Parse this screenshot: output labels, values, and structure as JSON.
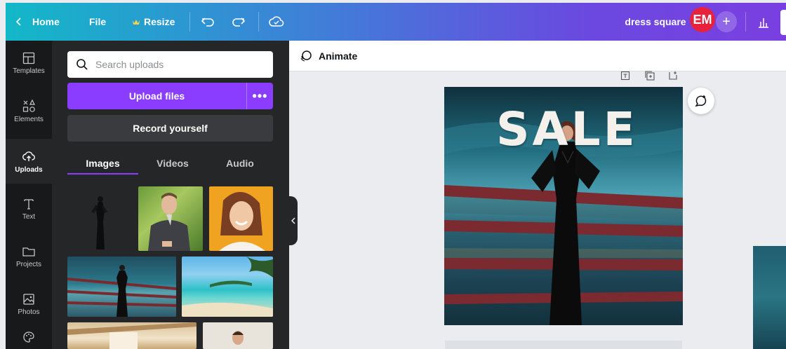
{
  "topbar": {
    "home_label": "Home",
    "file_label": "File",
    "resize_label": "Resize",
    "design_title": "dress square",
    "avatar_initials": "EM",
    "plus_label": "+"
  },
  "sidebar": {
    "items": [
      {
        "label": "Templates",
        "icon": "templates-icon"
      },
      {
        "label": "Elements",
        "icon": "elements-icon"
      },
      {
        "label": "Uploads",
        "icon": "upload-cloud-icon"
      },
      {
        "label": "Text",
        "icon": "text-icon"
      },
      {
        "label": "Projects",
        "icon": "folder-icon"
      },
      {
        "label": "Photos",
        "icon": "photos-icon"
      }
    ]
  },
  "panel": {
    "search_placeholder": "Search uploads",
    "upload_label": "Upload files",
    "upload_more_label": "•••",
    "record_label": "Record yourself",
    "tabs": [
      "Images",
      "Videos",
      "Audio"
    ]
  },
  "editor": {
    "animate_label": "Animate",
    "design_text": "SALE"
  },
  "colors": {
    "accent": "#8b3dff",
    "avatar": "#e8223d"
  }
}
